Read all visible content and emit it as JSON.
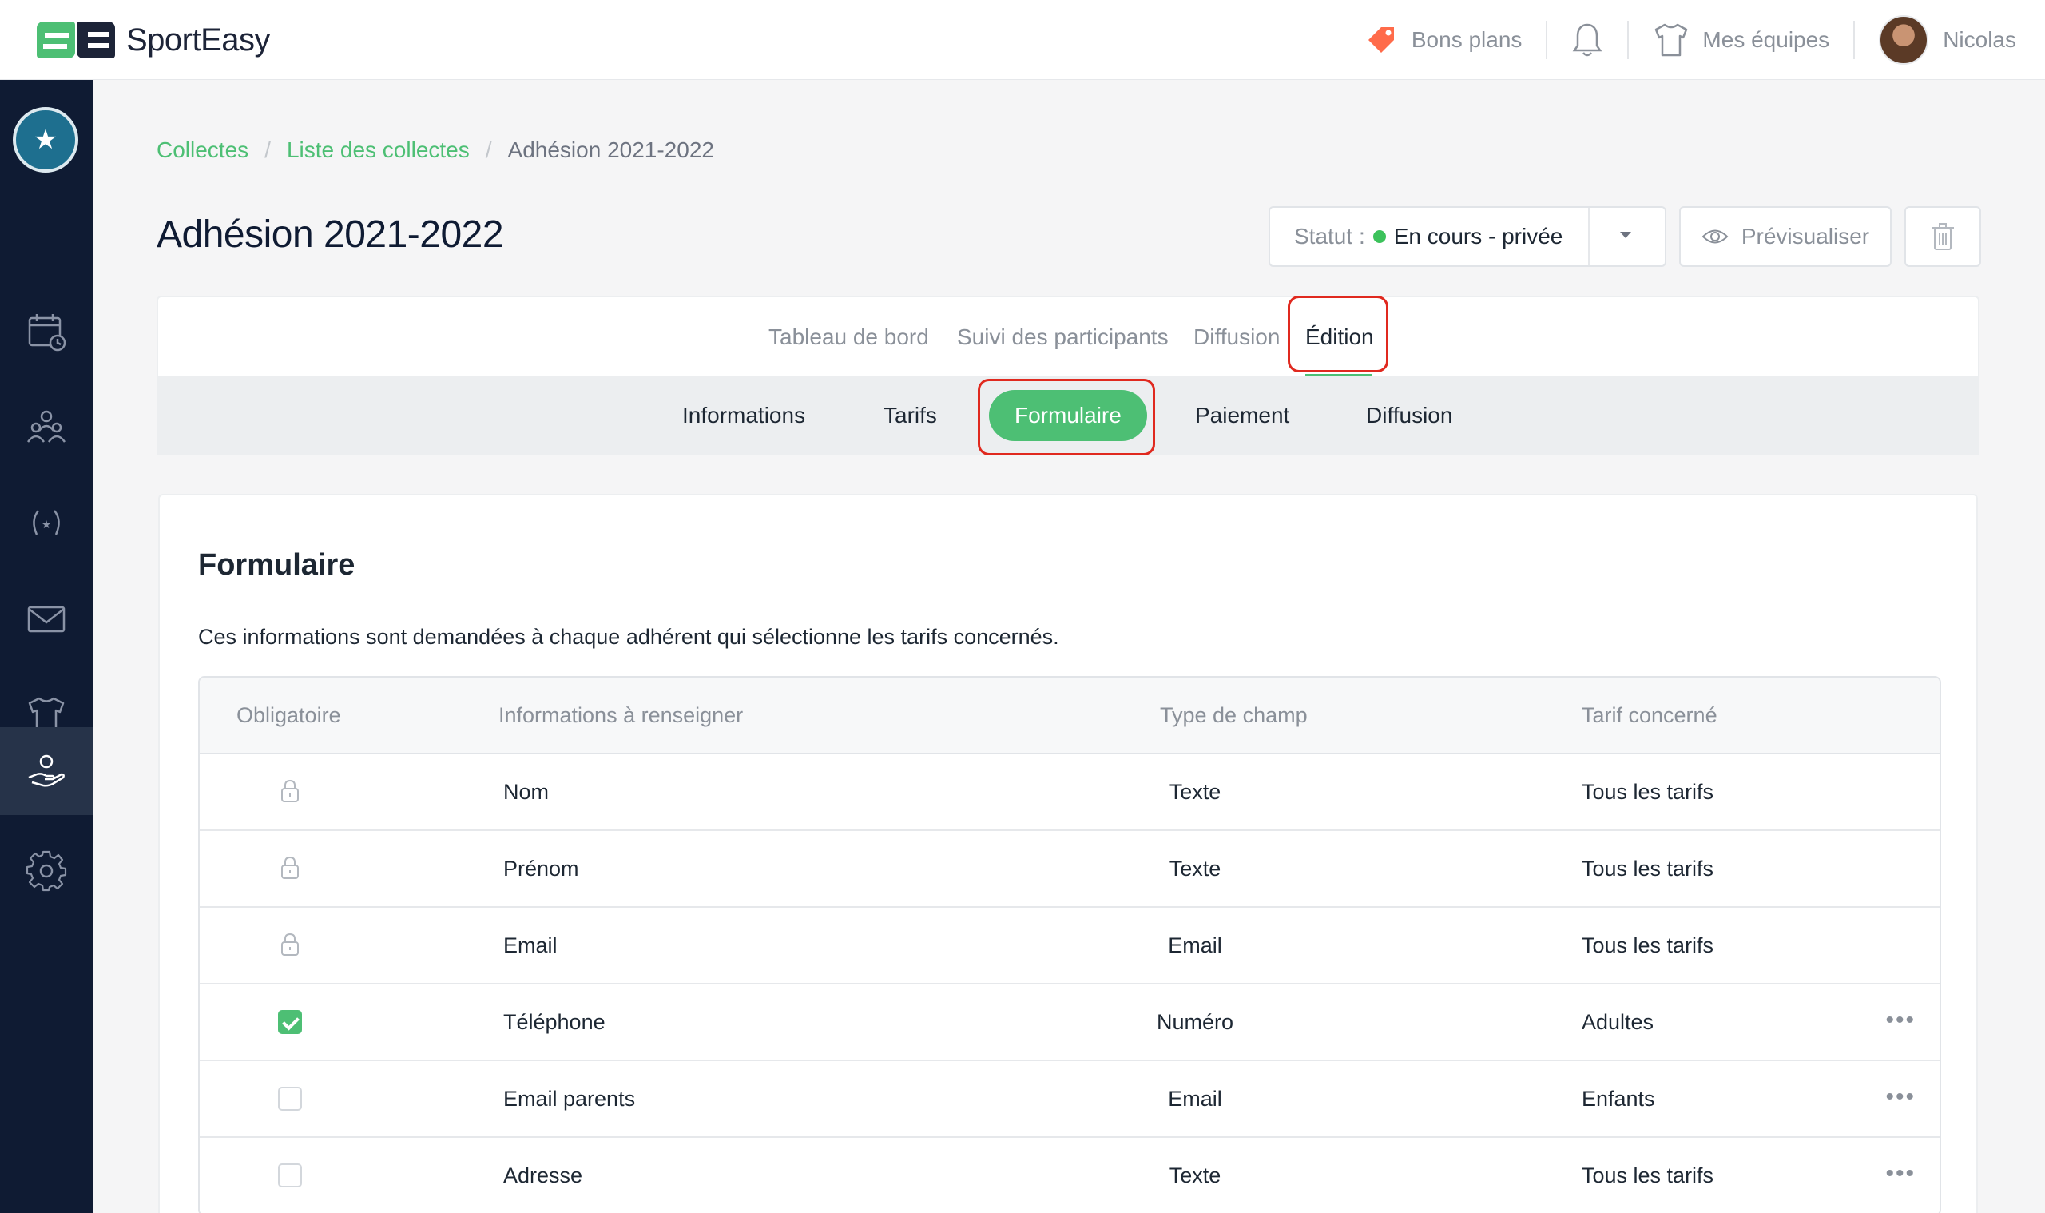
{
  "app": {
    "name": "SportEasy"
  },
  "topbar": {
    "deals_label": "Bons plans",
    "teams_label": "Mes équipes",
    "user_name": "Nicolas"
  },
  "breadcrumb": {
    "items": [
      "Collectes",
      "Liste des collectes"
    ],
    "current": "Adhésion 2021-2022",
    "separator": "/"
  },
  "page": {
    "title": "Adhésion 2021-2022",
    "status_label": "Statut :",
    "status_value": "En cours - privée",
    "preview_label": "Prévisualiser"
  },
  "main_tabs": [
    "Tableau de bord",
    "Suivi des participants",
    "Diffusion",
    "Édition"
  ],
  "main_tab_active": "Édition",
  "sub_tabs": [
    "Informations",
    "Tarifs",
    "Formulaire",
    "Paiement",
    "Diffusion"
  ],
  "sub_tab_active": "Formulaire",
  "form": {
    "title": "Formulaire",
    "description": "Ces informations sont demandées à chaque adhérent qui sélectionne les tarifs concernés.",
    "columns": [
      "Obligatoire",
      "Informations à renseigner",
      "Type de champ",
      "Tarif concerné"
    ],
    "rows": [
      {
        "required": "locked",
        "field": "Nom",
        "type": "Texte",
        "tariff": "Tous les tarifs"
      },
      {
        "required": "locked",
        "field": "Prénom",
        "type": "Texte",
        "tariff": "Tous les tarifs"
      },
      {
        "required": "locked",
        "field": "Email",
        "type": "Email",
        "tariff": "Tous les tarifs"
      },
      {
        "required": "checked",
        "field": "Téléphone",
        "type": "Numéro",
        "tariff": "Adultes"
      },
      {
        "required": "unchecked",
        "field": "Email parents",
        "type": "Email",
        "tariff": "Enfants"
      },
      {
        "required": "unchecked",
        "field": "Adresse",
        "type": "Texte",
        "tariff": "Tous les tarifs"
      }
    ]
  },
  "colors": {
    "brand_green": "#4dbf74",
    "sidebar_bg": "#0f1b33",
    "status_dot": "#3cc25b",
    "highlight_red": "#e0291f"
  },
  "icons": {
    "sidebar": [
      "calendar-icon",
      "members-icon",
      "laurel-icon",
      "mail-icon",
      "shirt-icon",
      "hand-donation-icon",
      "gear-icon"
    ]
  }
}
